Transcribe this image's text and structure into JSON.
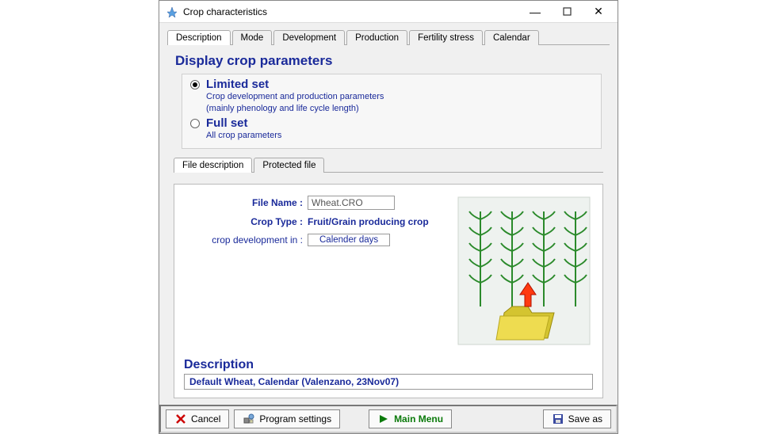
{
  "window": {
    "title": "Crop characteristics"
  },
  "tabs": [
    "Description",
    "Mode",
    "Development",
    "Production",
    "Fertility stress",
    "Calendar"
  ],
  "heading": "Display crop parameters",
  "options": {
    "limited": {
      "label": "Limited set",
      "desc1": "Crop development and production parameters",
      "desc2": "(mainly phenology and life cycle length)"
    },
    "full": {
      "label": "Full set",
      "desc1": "All crop parameters"
    }
  },
  "subtabs": [
    "File description",
    "Protected file"
  ],
  "form": {
    "filename_label": "File Name :",
    "filename_value": "Wheat.CRO",
    "croptype_label": "Crop Type :",
    "croptype_value": "Fruit/Grain producing crop",
    "dev_label": "crop development in :",
    "dev_button": "Calender days"
  },
  "description": {
    "heading": "Description",
    "value": "Default Wheat, Calendar (Valenzano, 23Nov07)"
  },
  "buttons": {
    "cancel": "Cancel",
    "program_settings": "Program settings",
    "main_menu": "Main Menu",
    "save_as": "Save as"
  }
}
